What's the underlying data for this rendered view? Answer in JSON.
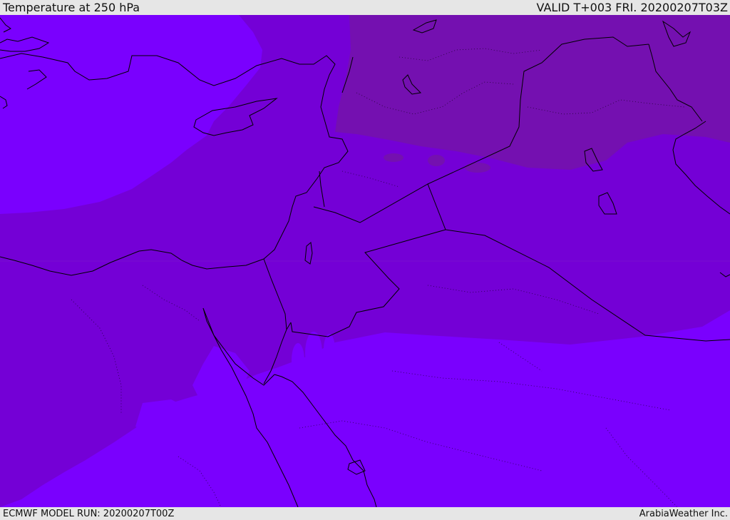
{
  "header": {
    "title": "Temperature at 250 hPa",
    "valid": "VALID T+003 FRI. 20200207T03Z"
  },
  "footer": {
    "model_run": "ECMWF MODEL RUN: 20200207T00Z",
    "credit": "ArabiaWeather Inc."
  },
  "palette": {
    "band_light": "#7a00fe",
    "band_mid": "#7400d6",
    "band_dark": "#7410b0",
    "coastline": "#000000"
  }
}
